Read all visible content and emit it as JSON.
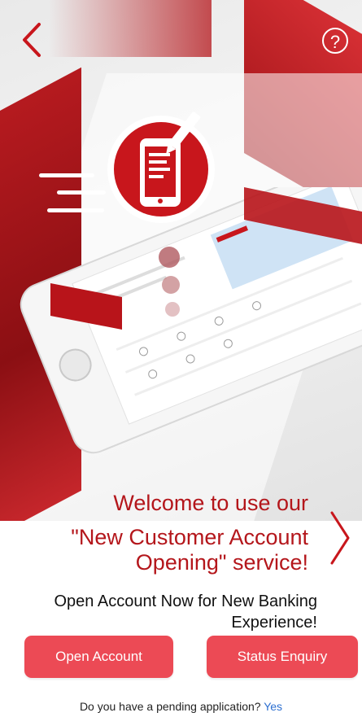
{
  "header": {
    "back_icon": "chevron-left-icon",
    "help_icon": "question-circle-icon",
    "help_glyph": "?"
  },
  "hero": {
    "illustration": "phone-with-form-icon",
    "colors": {
      "brand_red": "#b4161b",
      "button_red": "#ec4a55",
      "link_blue": "#2d6fd0"
    }
  },
  "welcome": {
    "line1": "Welcome to use our",
    "line2a": "\"New Customer Account",
    "line2b": "Opening\" service!"
  },
  "carousel": {
    "next_icon": "chevron-right-icon"
  },
  "subtitle": {
    "line1": "Open Account Now for New Banking",
    "line2": "Experience!"
  },
  "actions": {
    "open_account": "Open Account",
    "status_enquiry": "Status Enquiry"
  },
  "pending": {
    "question": "Do you have a pending application?",
    "yes": "Yes"
  }
}
